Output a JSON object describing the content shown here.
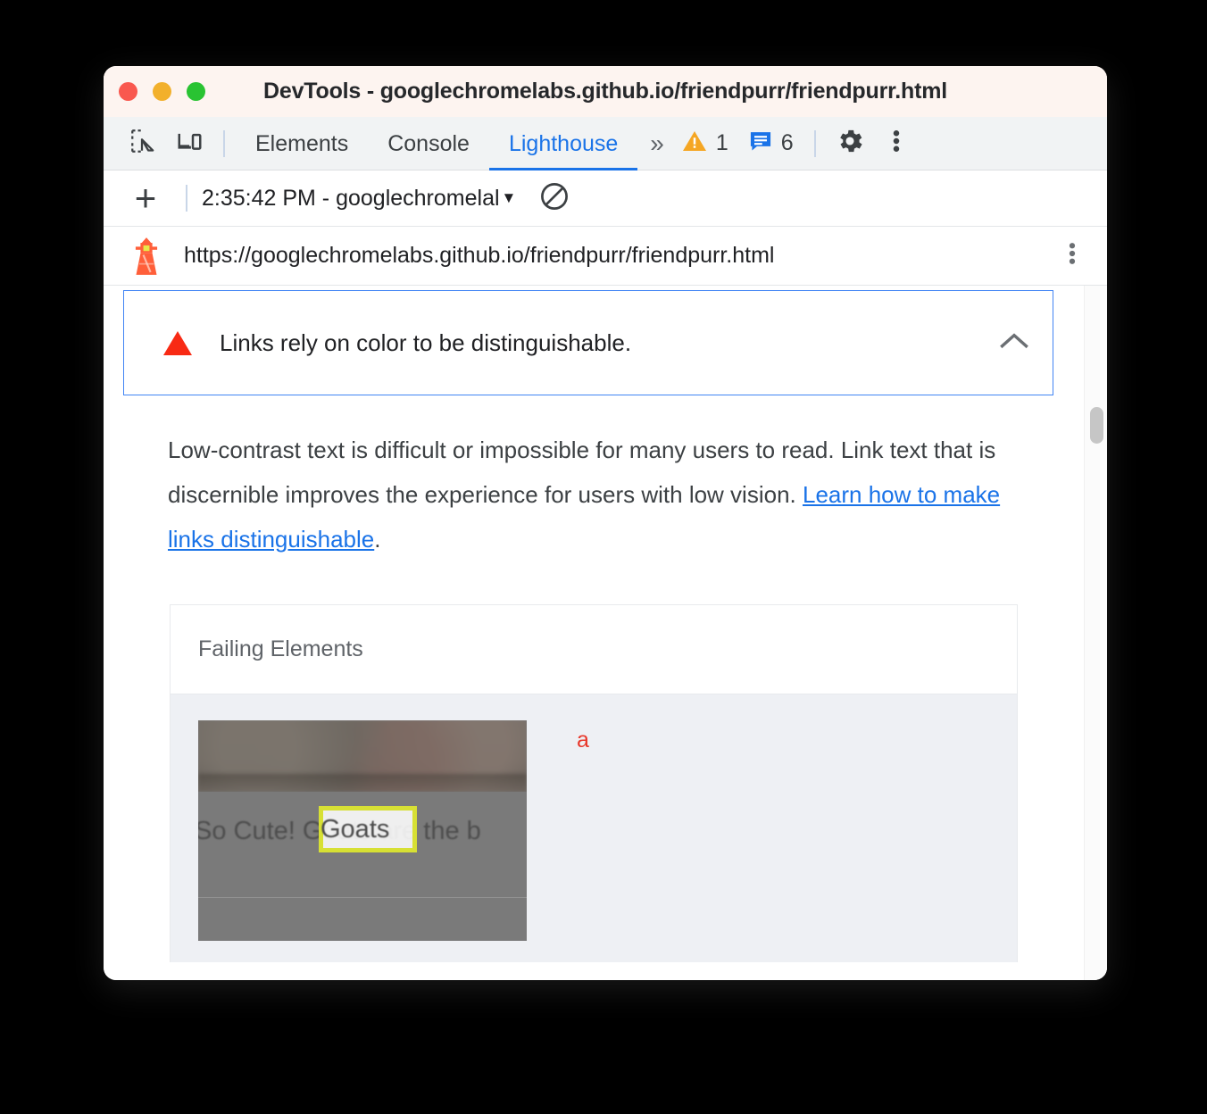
{
  "window": {
    "title": "DevTools - googlechromelabs.github.io/friendpurr/friendpurr.html",
    "traffic_lights": {
      "close_color": "#f9584f",
      "minimize_color": "#f2b02c",
      "maximize_color": "#29c332"
    }
  },
  "tabbar": {
    "inspect_icon": "inspect-element-icon",
    "device_icon": "device-toolbar-icon",
    "tabs": [
      {
        "label": "Elements",
        "active": false
      },
      {
        "label": "Console",
        "active": false
      },
      {
        "label": "Lighthouse",
        "active": true
      }
    ],
    "more_tabs_icon": "chevron-double-right-icon",
    "more_tabs_label": "»",
    "warning_count": "1",
    "message_count": "6",
    "settings_icon": "gear-icon",
    "kebab_icon": "more-vertical-icon",
    "active_tab_color": "#1a73e8",
    "warning_color": "#f5a623",
    "message_color": "#1a73e8"
  },
  "lighthouse_toolbar": {
    "new_run_label": "+",
    "new_run_icon": "plus-icon",
    "run_select_label": "2:35:42 PM - googlechromelal",
    "run_select_caret": "▼",
    "clear_icon": "clear-no-entry-icon"
  },
  "urlbar": {
    "logo_icon": "lighthouse-icon",
    "url": "https://googlechromelabs.github.io/friendpurr/friendpurr.html",
    "kebab_icon": "more-vertical-icon"
  },
  "audit": {
    "severity_icon": "failure-triangle-icon",
    "severity_color": "#f82a14",
    "title": "Links rely on color to be distinguishable.",
    "collapse_icon": "chevron-up-icon",
    "expanded": true,
    "description_part1": "Low-contrast text is difficult or impossible for many users to read. Link text that is discernible improves the experience for users with low vision. ",
    "description_link": "Learn how to make links distinguishable",
    "description_part2": ".",
    "link_color": "#1a73e8"
  },
  "failing_elements": {
    "header": "Failing Elements",
    "rows": [
      {
        "thumbnail_caption": "So Cute! Goats are the b",
        "highlighted_text": "Goats",
        "highlight_color": "#d7e034",
        "snippet": "a",
        "snippet_color": "#e8372a"
      }
    ]
  },
  "scrollbar": {
    "thumb_color": "#c6c6c6"
  }
}
